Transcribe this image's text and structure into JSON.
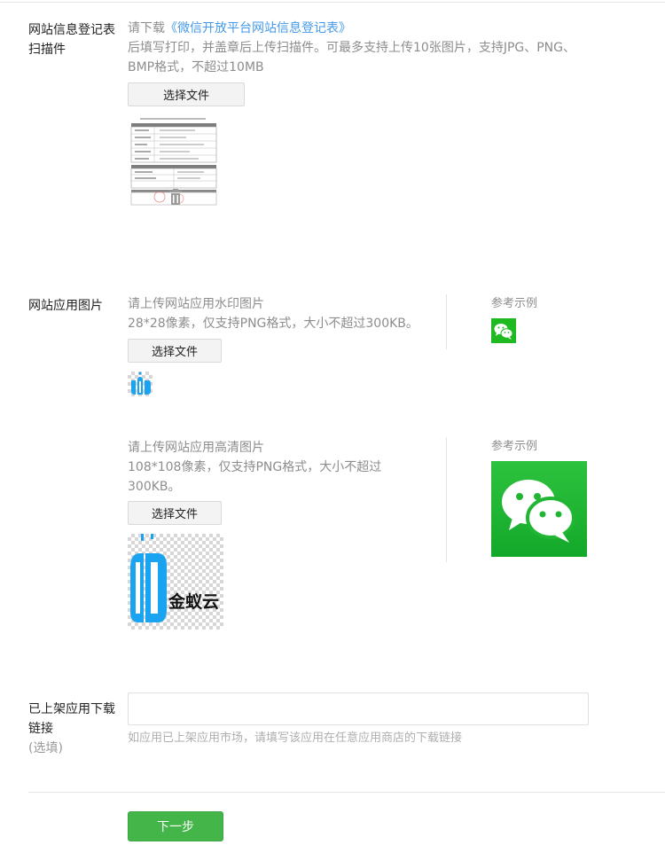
{
  "form_section": {
    "label_line1": "网站信息登记表",
    "label_line2": "扫描件",
    "download_prefix": "请下载",
    "download_link": "《微信开放平台网站信息登记表》",
    "hint_line1": "后填写打印，并盖章后上传扫描件。可最多支持上传10张图片，支持JPG、PNG、",
    "hint_line2": "BMP格式，不超过10MB",
    "file_button": "选择文件"
  },
  "app_image_section": {
    "label": "网站应用图片",
    "watermark": {
      "hint_line1": "请上传网站应用水印图片",
      "hint_line2": "28*28像素，仅支持PNG格式，大小不超过300KB。",
      "file_button": "选择文件",
      "ref_title": "参考示例"
    },
    "hd": {
      "hint_line1": "请上传网站应用高清图片",
      "hint_line2": "108*108像素，仅支持PNG格式，大小不超过",
      "hint_line3": "300KB。",
      "file_button": "选择文件",
      "ref_title": "参考示例",
      "logo_text": "金蚁云"
    }
  },
  "download_link_section": {
    "label_line1": "已上架应用下载",
    "label_line2": "链接",
    "optional": "(选填)",
    "input_value": "",
    "hint": "如应用已上架应用市场，请填写该应用在任意应用商店的下载链接"
  },
  "footer": {
    "next_button": "下一步"
  },
  "colors": {
    "link": "#459ae9",
    "primary_button": "#44b549",
    "wechat_green": "#1fb922",
    "logo_blue": "#1aa3f0"
  }
}
